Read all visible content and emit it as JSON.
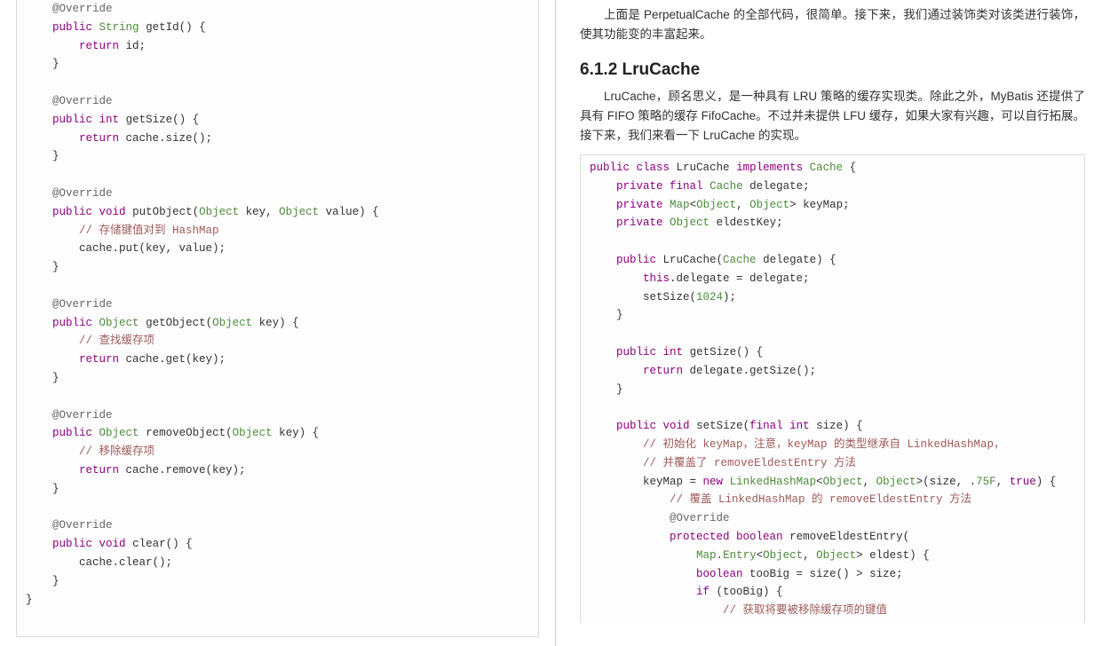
{
  "left": {
    "code_lines": [
      [
        [
          "p",
          "    "
        ],
        [
          "ann",
          "@Override"
        ]
      ],
      [
        [
          "p",
          "    "
        ],
        [
          "kw",
          "public"
        ],
        [
          "p",
          " "
        ],
        [
          "type",
          "String"
        ],
        [
          "p",
          " getId() {"
        ]
      ],
      [
        [
          "p",
          "        "
        ],
        [
          "kw",
          "return"
        ],
        [
          "p",
          " id;"
        ]
      ],
      [
        [
          "p",
          "    }"
        ]
      ],
      [
        [
          "p",
          ""
        ]
      ],
      [
        [
          "p",
          "    "
        ],
        [
          "ann",
          "@Override"
        ]
      ],
      [
        [
          "p",
          "    "
        ],
        [
          "kw",
          "public"
        ],
        [
          "p",
          " "
        ],
        [
          "kw",
          "int"
        ],
        [
          "p",
          " getSize() {"
        ]
      ],
      [
        [
          "p",
          "        "
        ],
        [
          "kw",
          "return"
        ],
        [
          "p",
          " cache.size();"
        ]
      ],
      [
        [
          "p",
          "    }"
        ]
      ],
      [
        [
          "p",
          ""
        ]
      ],
      [
        [
          "p",
          "    "
        ],
        [
          "ann",
          "@Override"
        ]
      ],
      [
        [
          "p",
          "    "
        ],
        [
          "kw",
          "public"
        ],
        [
          "p",
          " "
        ],
        [
          "kw",
          "void"
        ],
        [
          "p",
          " putObject("
        ],
        [
          "type",
          "Object"
        ],
        [
          "p",
          " key, "
        ],
        [
          "type",
          "Object"
        ],
        [
          "p",
          " value) {"
        ]
      ],
      [
        [
          "p",
          "        "
        ],
        [
          "cmt",
          "// 存储键值对到 HashMap"
        ]
      ],
      [
        [
          "p",
          "        cache.put(key, value);"
        ]
      ],
      [
        [
          "p",
          "    }"
        ]
      ],
      [
        [
          "p",
          ""
        ]
      ],
      [
        [
          "p",
          "    "
        ],
        [
          "ann",
          "@Override"
        ]
      ],
      [
        [
          "p",
          "    "
        ],
        [
          "kw",
          "public"
        ],
        [
          "p",
          " "
        ],
        [
          "type",
          "Object"
        ],
        [
          "p",
          " getObject("
        ],
        [
          "type",
          "Object"
        ],
        [
          "p",
          " key) {"
        ]
      ],
      [
        [
          "p",
          "        "
        ],
        [
          "cmt",
          "// 查找缓存项"
        ]
      ],
      [
        [
          "p",
          "        "
        ],
        [
          "kw",
          "return"
        ],
        [
          "p",
          " cache.get(key);"
        ]
      ],
      [
        [
          "p",
          "    }"
        ]
      ],
      [
        [
          "p",
          ""
        ]
      ],
      [
        [
          "p",
          "    "
        ],
        [
          "ann",
          "@Override"
        ]
      ],
      [
        [
          "p",
          "    "
        ],
        [
          "kw",
          "public"
        ],
        [
          "p",
          " "
        ],
        [
          "type",
          "Object"
        ],
        [
          "p",
          " removeObject("
        ],
        [
          "type",
          "Object"
        ],
        [
          "p",
          " key) {"
        ]
      ],
      [
        [
          "p",
          "        "
        ],
        [
          "cmt",
          "// 移除缓存项"
        ]
      ],
      [
        [
          "p",
          "        "
        ],
        [
          "kw",
          "return"
        ],
        [
          "p",
          " cache.remove(key);"
        ]
      ],
      [
        [
          "p",
          "    }"
        ]
      ],
      [
        [
          "p",
          ""
        ]
      ],
      [
        [
          "p",
          "    "
        ],
        [
          "ann",
          "@Override"
        ]
      ],
      [
        [
          "p",
          "    "
        ],
        [
          "kw",
          "public"
        ],
        [
          "p",
          " "
        ],
        [
          "kw",
          "void"
        ],
        [
          "p",
          " clear() {"
        ]
      ],
      [
        [
          "p",
          "        cache.clear();"
        ]
      ],
      [
        [
          "p",
          "    }"
        ]
      ],
      [
        [
          "p",
          "}"
        ]
      ]
    ]
  },
  "right": {
    "para1": "上面是 PerpetualCache 的全部代码，很简单。接下来，我们通过装饰类对该类进行装饰，使其功能变的丰富起来。",
    "heading": "6.1.2 LruCache",
    "para2": "LruCache，顾名思义，是一种具有 LRU 策略的缓存实现类。除此之外，MyBatis 还提供了具有 FIFO 策略的缓存 FifoCache。不过并未提供 LFU 缓存，如果大家有兴趣，可以自行拓展。接下来，我们来看一下 LruCache 的实现。",
    "code_lines": [
      [
        [
          "p",
          ""
        ],
        [
          "kw",
          "public"
        ],
        [
          "p",
          " "
        ],
        [
          "kw",
          "class"
        ],
        [
          "p",
          " LruCache "
        ],
        [
          "kw",
          "implements"
        ],
        [
          "p",
          " "
        ],
        [
          "type",
          "Cache"
        ],
        [
          "p",
          " {"
        ]
      ],
      [
        [
          "p",
          "    "
        ],
        [
          "kw",
          "private"
        ],
        [
          "p",
          " "
        ],
        [
          "kw",
          "final"
        ],
        [
          "p",
          " "
        ],
        [
          "type",
          "Cache"
        ],
        [
          "p",
          " delegate;"
        ]
      ],
      [
        [
          "p",
          "    "
        ],
        [
          "kw",
          "private"
        ],
        [
          "p",
          " "
        ],
        [
          "type",
          "Map"
        ],
        [
          "p",
          "<"
        ],
        [
          "type",
          "Object"
        ],
        [
          "p",
          ", "
        ],
        [
          "type",
          "Object"
        ],
        [
          "p",
          "> keyMap;"
        ]
      ],
      [
        [
          "p",
          "    "
        ],
        [
          "kw",
          "private"
        ],
        [
          "p",
          " "
        ],
        [
          "type",
          "Object"
        ],
        [
          "p",
          " eldestKey;"
        ]
      ],
      [
        [
          "p",
          ""
        ]
      ],
      [
        [
          "p",
          "    "
        ],
        [
          "kw",
          "public"
        ],
        [
          "p",
          " LruCache("
        ],
        [
          "type",
          "Cache"
        ],
        [
          "p",
          " delegate) {"
        ]
      ],
      [
        [
          "p",
          "        "
        ],
        [
          "kw",
          "this"
        ],
        [
          "p",
          ".delegate = delegate;"
        ]
      ],
      [
        [
          "p",
          "        setSize("
        ],
        [
          "num",
          "1024"
        ],
        [
          "p",
          ");"
        ]
      ],
      [
        [
          "p",
          "    }"
        ]
      ],
      [
        [
          "p",
          ""
        ]
      ],
      [
        [
          "p",
          "    "
        ],
        [
          "kw",
          "public"
        ],
        [
          "p",
          " "
        ],
        [
          "kw",
          "int"
        ],
        [
          "p",
          " getSize() {"
        ]
      ],
      [
        [
          "p",
          "        "
        ],
        [
          "kw",
          "return"
        ],
        [
          "p",
          " delegate.getSize();"
        ]
      ],
      [
        [
          "p",
          "    }"
        ]
      ],
      [
        [
          "p",
          ""
        ]
      ],
      [
        [
          "p",
          "    "
        ],
        [
          "kw",
          "public"
        ],
        [
          "p",
          " "
        ],
        [
          "kw",
          "void"
        ],
        [
          "p",
          " setSize("
        ],
        [
          "kw",
          "final"
        ],
        [
          "p",
          " "
        ],
        [
          "kw",
          "int"
        ],
        [
          "p",
          " size) {"
        ]
      ],
      [
        [
          "p",
          "        "
        ],
        [
          "cmt",
          "// 初始化 keyMap，注意，keyMap 的类型继承自 LinkedHashMap，"
        ]
      ],
      [
        [
          "p",
          "        "
        ],
        [
          "cmt",
          "// 并覆盖了 removeEldestEntry 方法"
        ]
      ],
      [
        [
          "p",
          "        keyMap = "
        ],
        [
          "kw",
          "new"
        ],
        [
          "p",
          " "
        ],
        [
          "type",
          "LinkedHashMap"
        ],
        [
          "p",
          "<"
        ],
        [
          "type",
          "Object"
        ],
        [
          "p",
          ", "
        ],
        [
          "type",
          "Object"
        ],
        [
          "p",
          ">(size, ."
        ],
        [
          "num",
          "75F"
        ],
        [
          "p",
          ", "
        ],
        [
          "kw",
          "true"
        ],
        [
          "p",
          ") {"
        ]
      ],
      [
        [
          "p",
          "            "
        ],
        [
          "cmt",
          "// 覆盖 LinkedHashMap 的 removeEldestEntry 方法"
        ]
      ],
      [
        [
          "p",
          "            "
        ],
        [
          "ann",
          "@Override"
        ]
      ],
      [
        [
          "p",
          "            "
        ],
        [
          "kw",
          "protected"
        ],
        [
          "p",
          " "
        ],
        [
          "kw",
          "boolean"
        ],
        [
          "p",
          " removeEldestEntry("
        ]
      ],
      [
        [
          "p",
          "                "
        ],
        [
          "type",
          "Map"
        ],
        [
          "p",
          "."
        ],
        [
          "type",
          "Entry"
        ],
        [
          "p",
          "<"
        ],
        [
          "type",
          "Object"
        ],
        [
          "p",
          ", "
        ],
        [
          "type",
          "Object"
        ],
        [
          "p",
          "> eldest) {"
        ]
      ],
      [
        [
          "p",
          "                "
        ],
        [
          "kw",
          "boolean"
        ],
        [
          "p",
          " tooBig = size() > size;"
        ]
      ],
      [
        [
          "p",
          "                "
        ],
        [
          "kw",
          "if"
        ],
        [
          "p",
          " (tooBig) {"
        ]
      ],
      [
        [
          "p",
          "                    "
        ],
        [
          "cmt",
          "// 获取将要被移除缓存项的键值"
        ]
      ]
    ]
  }
}
